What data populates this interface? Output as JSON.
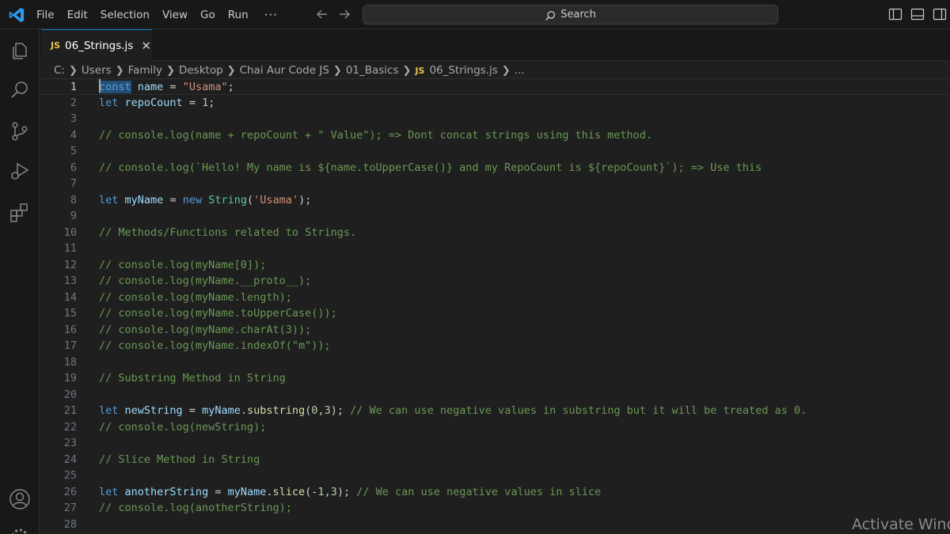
{
  "titlebar": {
    "menus": [
      "File",
      "Edit",
      "Selection",
      "View",
      "Go",
      "Run"
    ],
    "more": "···",
    "search_label": "Search"
  },
  "tabs": [
    {
      "badge": "JS",
      "label": "06_Strings.js",
      "close": "✕"
    }
  ],
  "breadcrumb": {
    "items": [
      "C:",
      "Users",
      "Family",
      "Desktop",
      "Chai Aur Code JS",
      "01_Basics"
    ],
    "file_badge": "JS",
    "file": "06_Strings.js",
    "tail": "..."
  },
  "editor": {
    "current_line": 1,
    "lines": [
      {
        "n": "1",
        "tokens": [
          [
            "kw-sel",
            "const"
          ],
          [
            "p",
            " "
          ],
          [
            "var",
            "name"
          ],
          [
            "p",
            " = "
          ],
          [
            "str",
            "\"Usama\""
          ],
          [
            "p",
            ";"
          ]
        ]
      },
      {
        "n": "2",
        "tokens": [
          [
            "kw",
            "let"
          ],
          [
            "p",
            " "
          ],
          [
            "var",
            "repoCount"
          ],
          [
            "p",
            " = "
          ],
          [
            "num",
            "1"
          ],
          [
            "p",
            ";"
          ]
        ]
      },
      {
        "n": "3",
        "tokens": []
      },
      {
        "n": "4",
        "tokens": [
          [
            "cm",
            "// console.log(name + repoCount + \" Value\"); => Dont concat strings using this method."
          ]
        ]
      },
      {
        "n": "5",
        "tokens": []
      },
      {
        "n": "6",
        "tokens": [
          [
            "cm",
            "// console.log(`Hello! My name is ${name.toUpperCase()} and my RepoCount is ${repoCount}`); => Use this"
          ]
        ]
      },
      {
        "n": "7",
        "tokens": []
      },
      {
        "n": "8",
        "tokens": [
          [
            "kw",
            "let"
          ],
          [
            "p",
            " "
          ],
          [
            "var",
            "myName"
          ],
          [
            "p",
            " = "
          ],
          [
            "kw",
            "new"
          ],
          [
            "p",
            " "
          ],
          [
            "cls",
            "String"
          ],
          [
            "p",
            "("
          ],
          [
            "str",
            "'Usama'"
          ],
          [
            "p",
            ");"
          ]
        ]
      },
      {
        "n": "9",
        "tokens": []
      },
      {
        "n": "10",
        "tokens": [
          [
            "cm",
            "// Methods/Functions related to Strings."
          ]
        ]
      },
      {
        "n": "11",
        "tokens": []
      },
      {
        "n": "12",
        "tokens": [
          [
            "cm",
            "// console.log(myName[0]);"
          ]
        ]
      },
      {
        "n": "13",
        "tokens": [
          [
            "cm",
            "// console.log(myName.__proto__);"
          ]
        ]
      },
      {
        "n": "14",
        "tokens": [
          [
            "cm",
            "// console.log(myName.length);"
          ]
        ]
      },
      {
        "n": "15",
        "tokens": [
          [
            "cm",
            "// console.log(myName.toUpperCase());"
          ]
        ]
      },
      {
        "n": "16",
        "tokens": [
          [
            "cm",
            "// console.log(myName.charAt(3));"
          ]
        ]
      },
      {
        "n": "17",
        "tokens": [
          [
            "cm",
            "// console.log(myName.indexOf(\"m\"));"
          ]
        ]
      },
      {
        "n": "18",
        "tokens": []
      },
      {
        "n": "19",
        "tokens": [
          [
            "cm",
            "// Substring Method in String"
          ]
        ]
      },
      {
        "n": "20",
        "tokens": []
      },
      {
        "n": "21",
        "tokens": [
          [
            "kw",
            "let"
          ],
          [
            "p",
            " "
          ],
          [
            "var",
            "newString"
          ],
          [
            "p",
            " = "
          ],
          [
            "var",
            "myName"
          ],
          [
            "p",
            "."
          ],
          [
            "fn",
            "substring"
          ],
          [
            "p",
            "("
          ],
          [
            "num",
            "0"
          ],
          [
            "p",
            ","
          ],
          [
            "num",
            "3"
          ],
          [
            "p",
            ");"
          ],
          [
            "p",
            " "
          ],
          [
            "cm",
            "// We can use negative values in substring but it will be treated as 0."
          ]
        ]
      },
      {
        "n": "22",
        "tokens": [
          [
            "cm",
            "// console.log(newString);"
          ]
        ]
      },
      {
        "n": "23",
        "tokens": []
      },
      {
        "n": "24",
        "tokens": [
          [
            "cm",
            "// Slice Method in String"
          ]
        ]
      },
      {
        "n": "25",
        "tokens": []
      },
      {
        "n": "26",
        "tokens": [
          [
            "kw",
            "let"
          ],
          [
            "p",
            " "
          ],
          [
            "var",
            "anotherString"
          ],
          [
            "p",
            " = "
          ],
          [
            "var",
            "myName"
          ],
          [
            "p",
            "."
          ],
          [
            "fn",
            "slice"
          ],
          [
            "p",
            "(-"
          ],
          [
            "num",
            "1"
          ],
          [
            "p",
            ","
          ],
          [
            "num",
            "3"
          ],
          [
            "p",
            ");"
          ],
          [
            "p",
            " "
          ],
          [
            "cm",
            "// We can use negative values in slice"
          ]
        ]
      },
      {
        "n": "27",
        "tokens": [
          [
            "cm",
            "// console.log(anotherString);"
          ]
        ]
      },
      {
        "n": "28",
        "tokens": []
      }
    ]
  },
  "watermark": "Activate Wind",
  "colors": {
    "keyword": "#569cd6",
    "variable": "#9cdcfe",
    "string": "#ce9178",
    "number": "#b5cea8",
    "function": "#dcdcaa",
    "class": "#4ec9b0",
    "comment": "#6a9955",
    "accent": "#0078d4"
  },
  "icons": {
    "logo": "vscode-logo-icon",
    "activity": [
      "explorer-icon",
      "search-icon",
      "source-control-icon",
      "run-debug-icon",
      "extensions-icon",
      "account-icon"
    ]
  }
}
